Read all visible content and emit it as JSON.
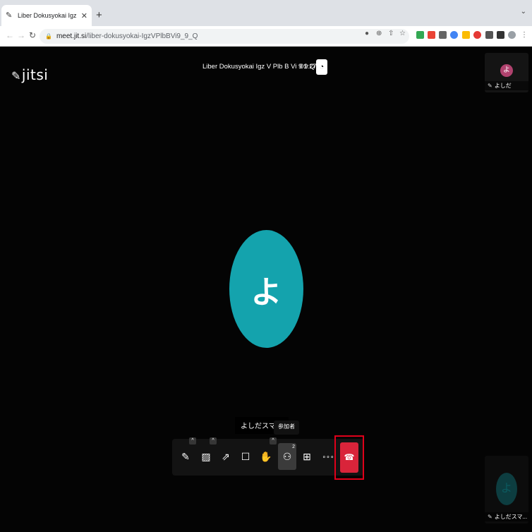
{
  "browser": {
    "tab_title": "Liber Dokusyokai Igz V Plb B Vi 9 9 Q",
    "url_host": "meet.jit.si",
    "url_path": "/liber-dokusyokai-IgzVPlbBVi9_9_Q"
  },
  "meeting": {
    "logo_text": "jitsi",
    "title": "Liber Dokusyokai Igz V Plb B Vi 9 9 Q",
    "timer": "01:27",
    "main_avatar_initial": "よ"
  },
  "participants": [
    {
      "name": "よしだ",
      "initial": "よ",
      "color": "#b0426e"
    },
    {
      "name": "よしだスマ...",
      "initial": "よ",
      "color": "#0d3d40"
    }
  ],
  "name_tag": "よしだスマホ",
  "tooltip": "参加者",
  "controls": {
    "participants_count": "2"
  },
  "colors": {
    "avatar_main": "#14a3ad",
    "hangup": "#d9243a",
    "highlight_box": "#e0001a"
  }
}
